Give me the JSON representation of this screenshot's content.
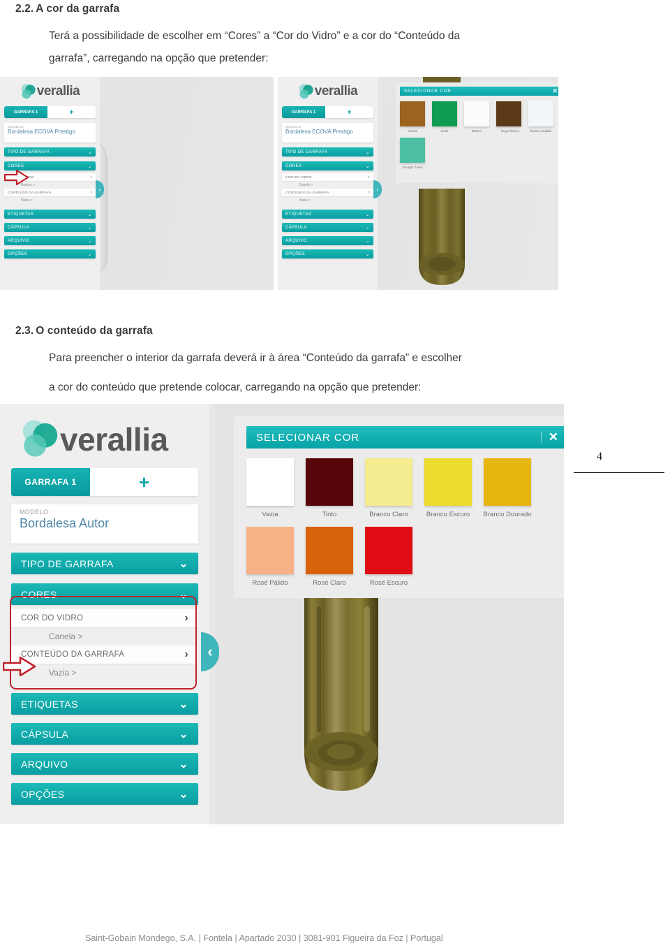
{
  "document": {
    "sections": [
      {
        "number": "2.2.",
        "title": "A cor da garrafa",
        "paragraph_line1": "Terá a possibilidade de escolher em “Cores” a “Cor do Vidro” e a cor do “Conteúdo da",
        "paragraph_line2": "garrafa”, carregando na opção que pretender:"
      },
      {
        "number": "2.3.",
        "title": "O conteúdo da garrafa",
        "paragraph_line1": "Para preencher o interior da garrafa deverá ir à área “Conteúdo da garrafa” e escolher",
        "paragraph_line2": "a cor do conteúdo que pretende colocar, carregando na opção que pretender:"
      }
    ],
    "page_number": "4",
    "footer": "Saint-Gobain Mondego, S.A. | Fontela | Apartado 2030 | 3081-901 Figueira da Foz | Portugal"
  },
  "brand": {
    "name": "verallia",
    "teal": "#0fa9ab",
    "teal_dark": "#089a9e",
    "annotation_red": "#c0202a"
  },
  "configurator": {
    "tab_label": "GARRAFA 1",
    "add_tab_icon": "plus-icon",
    "modelo_label": "MODELO:",
    "collapse_icon": "chevron-left-icon",
    "chevron_down_icon": "chevron-down-icon",
    "chevron_right_icon": "chevron-right-icon",
    "sections": {
      "tipo_de_garrafa": "TIPO DE GARRAFA",
      "cores": "CORES",
      "cor_do_vidro": "COR DO VIDRO",
      "conteudo_da_garrafa": "CONTEÚDO DA GARRAFA",
      "etiquetas": "ETIQUETAS",
      "capsula": "CÁPSULA",
      "arquivo": "ARQUIVO",
      "opcoes": "OPÇÕES"
    }
  },
  "screenshot_1a": {
    "modelo_value": "Bordalesa ECOVA Prestigo",
    "cor_do_vidro_value": "Branco  >",
    "conteudo_value": "Vazia  >",
    "bottle_color": "#f2f3f4",
    "bottle_caption": "clear-glass-bottle"
  },
  "screenshot_1b": {
    "modelo_value": "Bordalesa ECOVA Prestigo",
    "cor_do_vidro_value": "Canela  >",
    "conteudo_value": "Vazia  >",
    "bottle_color": "#6e6326",
    "bottle_caption": "canela-glass-bottle"
  },
  "glass_color_picker": {
    "title": "SELECIONAR COR",
    "close_icon": "close-icon",
    "swatches": [
      {
        "label": "Canela",
        "color": "#9a6420"
      },
      {
        "label": "Verde",
        "color": "#0f9b52"
      },
      {
        "label": "Branco",
        "color": "#fbfbfa"
      },
      {
        "label": "Negro Ibérico",
        "color": "#5c3a18"
      },
      {
        "label": "Branco Azulado",
        "color": "#f2f6fb"
      },
      {
        "label": "Georgia Green",
        "color": "#4cbfa3"
      }
    ]
  },
  "screenshot_2": {
    "modelo_value": "Bordalesa Autor",
    "cor_do_vidro_value": "Canela  >",
    "conteudo_value": "Vazia  >",
    "bottle_color": "#6e6326",
    "bottle_caption": "canela-glass-bottle-large"
  },
  "content_color_picker": {
    "title": "SELECIONAR COR",
    "close_icon": "close-icon",
    "swatches": [
      {
        "label": "Vazia",
        "color": "#ffffff"
      },
      {
        "label": "Tinto",
        "color": "#56060a"
      },
      {
        "label": "Branco Claro",
        "color": "#f5eb8f"
      },
      {
        "label": "Branco Escuro",
        "color": "#ecdc2e"
      },
      {
        "label": "Branco Dourado",
        "color": "#e7b510"
      },
      {
        "label": "Rosé Pálido",
        "color": "#f6b186"
      },
      {
        "label": "Rosé Claro",
        "color": "#d9620d"
      },
      {
        "label": "Rosé Escuro",
        "color": "#e00d17"
      }
    ]
  }
}
